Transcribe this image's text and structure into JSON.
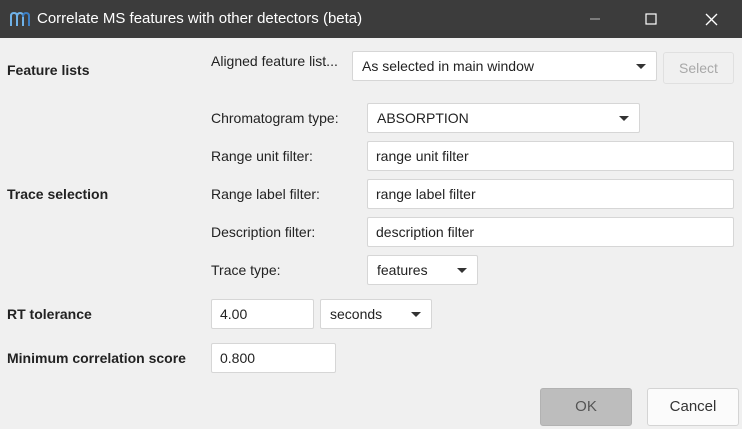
{
  "window": {
    "title": "Correlate MS features with other detectors (beta)",
    "title_bar_color": "#3c3c3c",
    "app_icon": "mzmine-logo-icon",
    "controls": [
      "minimize-icon",
      "maximize-icon",
      "close-icon"
    ]
  },
  "sections": {
    "feature_lists": "Feature lists",
    "trace_selection": "Trace selection",
    "rt_tolerance": "RT tolerance",
    "min_correlation": "Minimum correlation score"
  },
  "feature_lists": {
    "label": "Aligned feature list...",
    "value": "As selected in main window",
    "select_button": "Select"
  },
  "trace_selection": {
    "chromatogram_type_label": "Chromatogram type:",
    "chromatogram_type_value": "ABSORPTION",
    "range_unit_label": "Range unit filter:",
    "range_unit_value": "range unit filter",
    "range_label_label": "Range label filter:",
    "range_label_value": "range label filter",
    "description_label": "Description filter:",
    "description_value": "description filter",
    "trace_type_label": "Trace type:",
    "trace_type_value": "features"
  },
  "rt_tolerance": {
    "value": "4.00",
    "unit": "seconds"
  },
  "min_correlation": {
    "value": "0.800"
  },
  "footer": {
    "ok": "OK",
    "cancel": "Cancel"
  }
}
